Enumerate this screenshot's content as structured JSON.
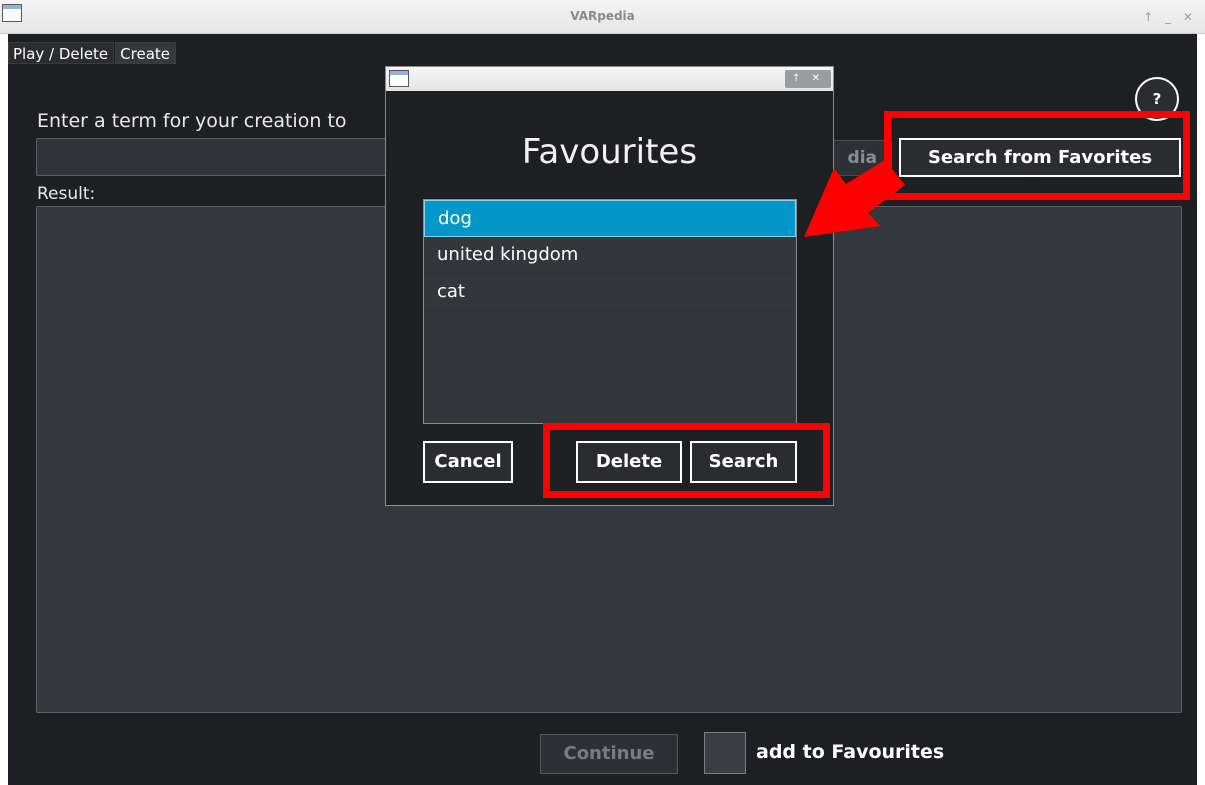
{
  "window": {
    "title": "VARpedia",
    "controls": "↑ _ ✕"
  },
  "tabs": [
    {
      "label": "Play / Delete"
    },
    {
      "label": "Create"
    }
  ],
  "help": {
    "label": "?"
  },
  "create": {
    "prompt_label": "Enter a term for your creation to",
    "term_value": "",
    "wiki_button_partial": "dia",
    "fav_search_button": "Search from Favorites",
    "result_label": "Result:",
    "continue_button": "Continue",
    "add_fav_label": "add to Favourites"
  },
  "dialog": {
    "controls": "↑ ✕",
    "heading": "Favourites",
    "items": [
      {
        "label": "dog",
        "selected": true
      },
      {
        "label": "united kingdom",
        "selected": false
      },
      {
        "label": "cat",
        "selected": false
      }
    ],
    "buttons": {
      "cancel": "Cancel",
      "delete": "Delete",
      "search": "Search"
    }
  },
  "annotation_color": "#ff0000",
  "selection_color": "#0596c8"
}
